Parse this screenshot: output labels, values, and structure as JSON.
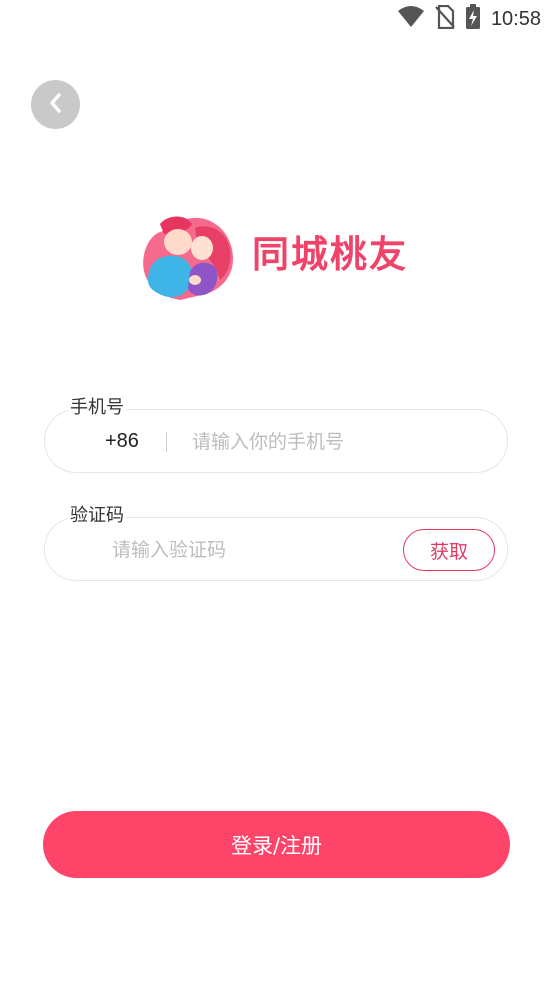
{
  "status_bar": {
    "time": "10:58",
    "icons": [
      "wifi-icon",
      "no-sim-icon",
      "battery-charging-icon"
    ]
  },
  "back_button": {
    "icon": "chevron-left-icon"
  },
  "logo": {
    "icon": "couple-logo-icon",
    "name": "同城桃友"
  },
  "phone_field": {
    "label": "手机号",
    "country_code": "+86",
    "value": "",
    "placeholder": "请输入你的手机号"
  },
  "code_field": {
    "label": "验证码",
    "value": "",
    "placeholder": "请输入验证码",
    "get_code_label": "获取"
  },
  "login_button": {
    "label": "登录/注册"
  },
  "colors": {
    "accent": "#fe4468",
    "brand_text": "#f0436a",
    "back_button_bg": "#c9c9c9"
  }
}
